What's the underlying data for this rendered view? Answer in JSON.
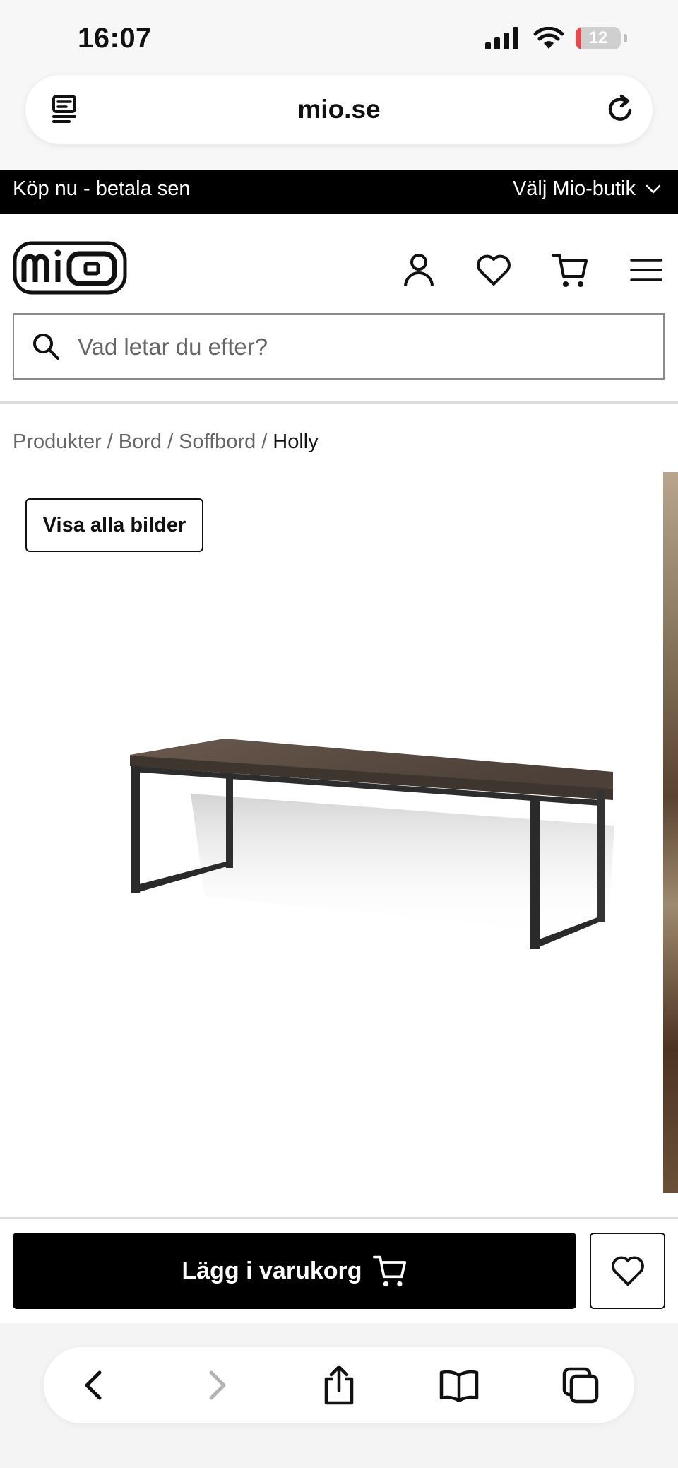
{
  "status_bar": {
    "time": "16:07",
    "battery_level": "12",
    "battery_fraction": 0.12,
    "battery_color": "#e5484d"
  },
  "browser": {
    "url": "mio.se",
    "icons": [
      "reader-icon",
      "reload-icon"
    ]
  },
  "promo_bar": {
    "left_text": "Köp nu - betala sen",
    "store_selector": "Välj Mio-butik"
  },
  "header": {
    "logo_text": "mio",
    "icons": [
      "account-icon",
      "heart-icon",
      "cart-icon",
      "menu-icon"
    ],
    "search_placeholder": "Vad letar du efter?"
  },
  "breadcrumb": {
    "items": [
      "Produkter",
      "Bord",
      "Soffbord"
    ],
    "current": "Holly",
    "separator": "/"
  },
  "gallery": {
    "view_all_label": "Visa alla bilder"
  },
  "actions": {
    "add_to_cart_label": "Lägg i varukorg"
  },
  "bottom_toolbar": {
    "icons": [
      "back-icon",
      "forward-icon",
      "share-icon",
      "bookmarks-icon",
      "tabs-icon"
    ]
  },
  "colors": {
    "promo_background": "#000000",
    "cart_button": "#000000",
    "divider": "#dcdcdc"
  }
}
